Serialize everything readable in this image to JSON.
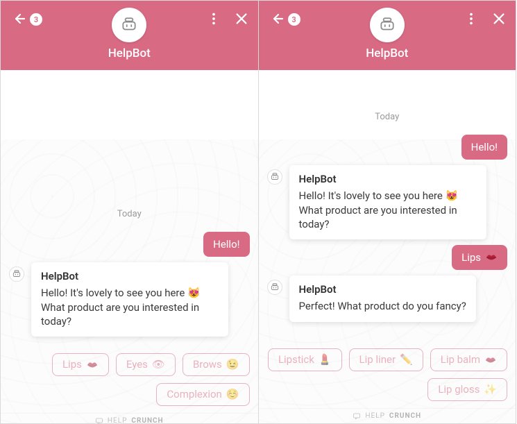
{
  "colors": {
    "accent": "#d96a84"
  },
  "header": {
    "bot_name": "HelpBot",
    "badge_count": "3"
  },
  "icons": {
    "back": "back-arrow-icon",
    "menu": "more-vertical-icon",
    "close": "close-icon",
    "bot": "bot-icon",
    "brand": "chat-bubble-icon"
  },
  "footer": {
    "brand_prefix": "HELP",
    "brand_bold": "CRUNCH"
  },
  "left": {
    "day": "Today",
    "user_msg1": "Hello!",
    "bot_from": "HelpBot",
    "bot_msg1_line1": "Hello! It's lovely to see you here",
    "bot_msg1_line2": " What product are you interested in today?",
    "bot_msg1_emoji": "😻",
    "chips": [
      {
        "label": "Lips",
        "emoji": "👄"
      },
      {
        "label": "Eyes",
        "emoji": "👁"
      },
      {
        "label": "Brows",
        "emoji": "😉"
      },
      {
        "label": "Complexion",
        "emoji": "☺️"
      }
    ]
  },
  "right": {
    "day": "Today",
    "user_msg1": "Hello!",
    "bot_from": "HelpBot",
    "bot_msg1_line1": "Hello! It's lovely to see you here",
    "bot_msg1_line2": " What product are you interested in today?",
    "bot_msg1_emoji": "😻",
    "user_msg2": "Lips",
    "user_msg2_emoji": "👄",
    "bot_msg2": "Perfect!  What product do you fancy?",
    "chips": [
      {
        "label": "Lipstick",
        "emoji": "💄"
      },
      {
        "label": "Lip liner",
        "emoji": "✏️"
      },
      {
        "label": "Lip balm",
        "emoji": "👄"
      },
      {
        "label": "Lip gloss",
        "emoji": "✨"
      }
    ]
  }
}
